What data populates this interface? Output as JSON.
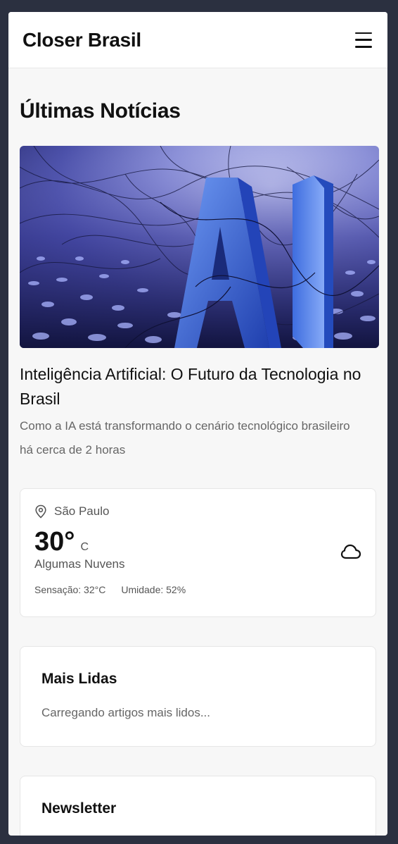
{
  "header": {
    "brand": "Closer Brasil",
    "menu_icon": "menu-icon"
  },
  "main": {
    "section_title": "Últimas Notícias",
    "featured": {
      "image_alt": "AI",
      "title": "Inteligência Artificial: O Futuro da Tecnologia no Brasil",
      "description": "Como a IA está transformando o cenário tecnológico brasileiro",
      "time": "há cerca de 2 horas"
    }
  },
  "weather": {
    "location": "São Paulo",
    "location_icon": "map-pin-icon",
    "temperature": "30°",
    "unit": "C",
    "condition": "Algumas Nuvens",
    "feels_like": "Sensação: 32°C",
    "humidity": "Umidade: 52%",
    "condition_icon": "cloud-icon"
  },
  "most_read": {
    "title": "Mais Lidas",
    "loading_text": "Carregando artigos mais lidos..."
  },
  "newsletter": {
    "title": "Newsletter"
  },
  "colors": {
    "background": "#2b3040",
    "surface": "#f7f7f7",
    "card": "#ffffff",
    "text": "#111111",
    "muted": "#666666"
  }
}
